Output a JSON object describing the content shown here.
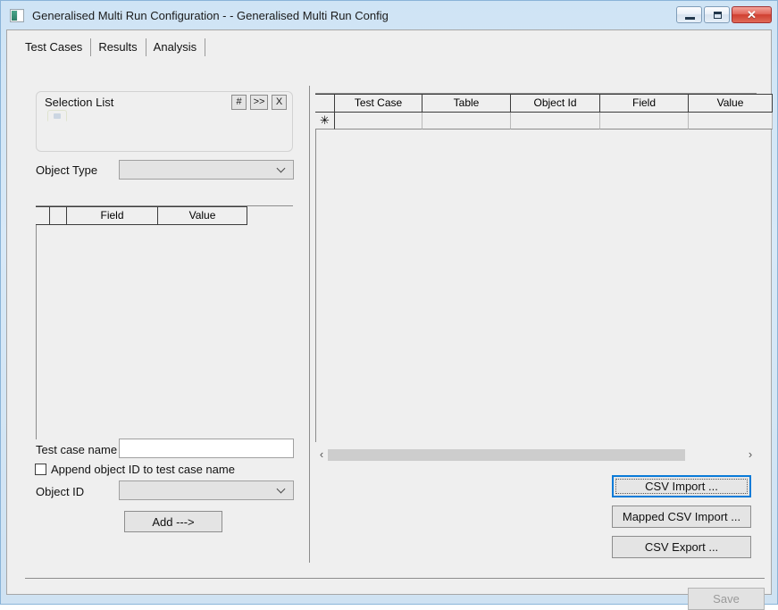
{
  "window": {
    "title": "Generalised Multi Run Configuration -  - Generalised Multi Run Config",
    "icon": "app-icon",
    "controls": {
      "minimize": "minimize-icon",
      "maximize": "maximize-icon",
      "close": "✕"
    }
  },
  "tabs": [
    {
      "label": "Test Cases",
      "selected": true
    },
    {
      "label": "Results",
      "selected": false
    },
    {
      "label": "Analysis",
      "selected": false
    }
  ],
  "left_panel": {
    "selection_list": {
      "title": "Selection List",
      "buttons": [
        {
          "label": "#",
          "name": "hash-button"
        },
        {
          "label": ">>",
          "name": "advance-button"
        },
        {
          "label": "X",
          "name": "clear-button"
        }
      ],
      "content": ""
    },
    "object_type": {
      "label": "Object Type",
      "value": "",
      "placeholder": ""
    },
    "field_grid": {
      "columns": [
        "",
        "",
        "Field",
        "Value"
      ],
      "rows": []
    },
    "test_case_name": {
      "label": "Test case name",
      "value": "",
      "placeholder": ""
    },
    "append_checkbox": {
      "label": "Append object ID to test case name",
      "checked": false
    },
    "object_id": {
      "label": "Object ID",
      "value": "",
      "placeholder": ""
    },
    "add_button": {
      "label": "Add --->"
    }
  },
  "right_panel": {
    "grid": {
      "columns": [
        "",
        "Test Case",
        "Table",
        "Object Id",
        "Field",
        "Value"
      ],
      "new_row_marker": "✳",
      "rows": []
    },
    "hscroll": {
      "left_arrow": "‹",
      "right_arrow": "›"
    },
    "buttons": [
      {
        "label": "CSV Import ...",
        "name": "csv-import-button",
        "focused": true
      },
      {
        "label": "Mapped CSV Import ...",
        "name": "mapped-csv-import-button",
        "focused": false
      },
      {
        "label": "CSV Export ...",
        "name": "csv-export-button",
        "focused": false
      }
    ]
  },
  "footer": {
    "save_button": {
      "label": "Save",
      "enabled": false
    }
  }
}
